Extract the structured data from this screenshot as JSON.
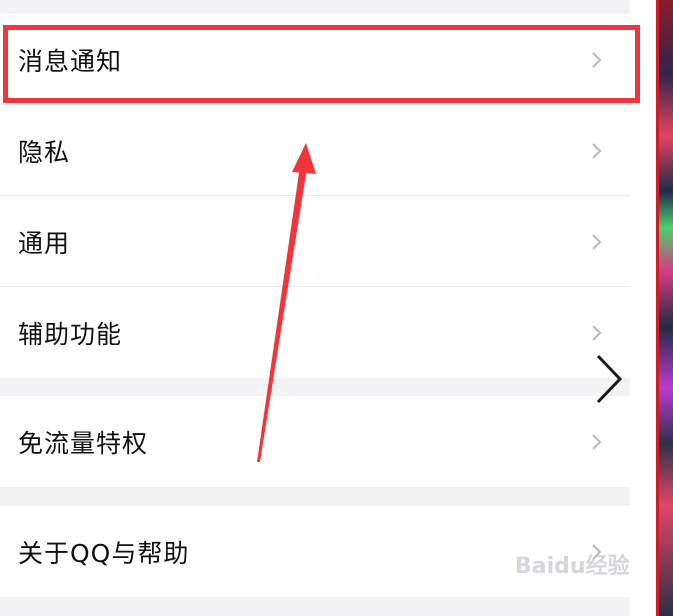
{
  "settings": {
    "items": [
      {
        "label": "消息通知"
      },
      {
        "label": "隐私"
      },
      {
        "label": "通用"
      },
      {
        "label": "辅助功能"
      },
      {
        "label": "免流量特权"
      },
      {
        "label": "关于QQ与帮助"
      }
    ]
  },
  "icons": {
    "row_chevron": "chevron-right-icon",
    "pager_chevron": "chevron-right-icon"
  },
  "watermark": "Baidu经验",
  "colors": {
    "highlight": "#f1353a",
    "background": "#f3f3f6",
    "text": "#111111",
    "chevron": "#b9b9c0"
  }
}
